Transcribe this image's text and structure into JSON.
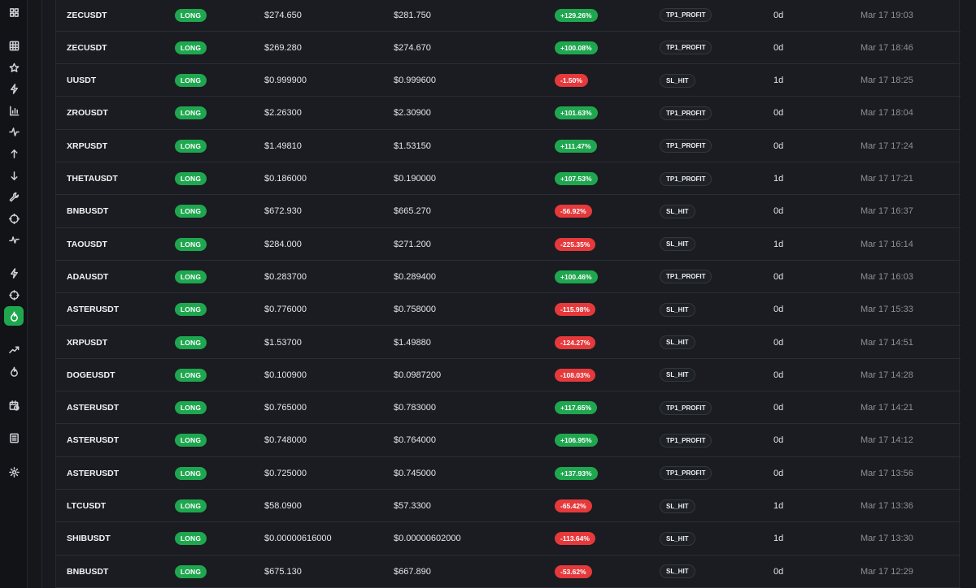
{
  "sidebar": {
    "icons": [
      {
        "name": "dashboard-grid-icon",
        "active": false
      },
      {
        "name": "table-grid-icon",
        "active": false
      },
      {
        "name": "star-icon",
        "active": false
      },
      {
        "name": "lightning-icon",
        "active": false
      },
      {
        "name": "bar-chart-icon",
        "active": false
      },
      {
        "name": "activity-icon",
        "active": false
      },
      {
        "name": "arrow-up-icon",
        "active": false
      },
      {
        "name": "arrow-down-icon",
        "active": false
      },
      {
        "name": "wrench-icon",
        "active": false
      },
      {
        "name": "crosshair-icon",
        "active": false
      },
      {
        "name": "pulse-icon",
        "active": false
      },
      {
        "name": "bolt-icon",
        "active": false
      },
      {
        "name": "target-icon",
        "active": false
      },
      {
        "name": "flame-icon",
        "active": true
      },
      {
        "name": "trending-up-icon",
        "active": false
      },
      {
        "name": "fire-icon",
        "active": false
      },
      {
        "name": "calendar-clock-icon",
        "active": false
      },
      {
        "name": "document-list-icon",
        "active": false
      },
      {
        "name": "settings-gear-icon",
        "active": false
      }
    ]
  },
  "colors": {
    "positive": "#1fa74f",
    "negative": "#e5393b",
    "background": "#17191e"
  },
  "trades": [
    {
      "symbol": "ZECUSDT",
      "side": "LONG",
      "entry": "$274.650",
      "exit": "$281.750",
      "pnl": "+129.26%",
      "pnl_sign": "pos",
      "reason": "TP1_PROFIT",
      "duration": "0d",
      "time": "Mar 17 19:03"
    },
    {
      "symbol": "ZECUSDT",
      "side": "LONG",
      "entry": "$269.280",
      "exit": "$274.670",
      "pnl": "+100.08%",
      "pnl_sign": "pos",
      "reason": "TP1_PROFIT",
      "duration": "0d",
      "time": "Mar 17 18:46"
    },
    {
      "symbol": "UUSDT",
      "side": "LONG",
      "entry": "$0.999900",
      "exit": "$0.999600",
      "pnl": "-1.50%",
      "pnl_sign": "neg",
      "reason": "SL_HIT",
      "duration": "1d",
      "time": "Mar 17 18:25"
    },
    {
      "symbol": "ZROUSDT",
      "side": "LONG",
      "entry": "$2.26300",
      "exit": "$2.30900",
      "pnl": "+101.63%",
      "pnl_sign": "pos",
      "reason": "TP1_PROFIT",
      "duration": "0d",
      "time": "Mar 17 18:04"
    },
    {
      "symbol": "XRPUSDT",
      "side": "LONG",
      "entry": "$1.49810",
      "exit": "$1.53150",
      "pnl": "+111.47%",
      "pnl_sign": "pos",
      "reason": "TP1_PROFIT",
      "duration": "0d",
      "time": "Mar 17 17:24"
    },
    {
      "symbol": "THETAUSDT",
      "side": "LONG",
      "entry": "$0.186000",
      "exit": "$0.190000",
      "pnl": "+107.53%",
      "pnl_sign": "pos",
      "reason": "TP1_PROFIT",
      "duration": "1d",
      "time": "Mar 17 17:21"
    },
    {
      "symbol": "BNBUSDT",
      "side": "LONG",
      "entry": "$672.930",
      "exit": "$665.270",
      "pnl": "-56.92%",
      "pnl_sign": "neg",
      "reason": "SL_HIT",
      "duration": "0d",
      "time": "Mar 17 16:37"
    },
    {
      "symbol": "TAOUSDT",
      "side": "LONG",
      "entry": "$284.000",
      "exit": "$271.200",
      "pnl": "-225.35%",
      "pnl_sign": "neg",
      "reason": "SL_HIT",
      "duration": "1d",
      "time": "Mar 17 16:14"
    },
    {
      "symbol": "ADAUSDT",
      "side": "LONG",
      "entry": "$0.283700",
      "exit": "$0.289400",
      "pnl": "+100.46%",
      "pnl_sign": "pos",
      "reason": "TP1_PROFIT",
      "duration": "0d",
      "time": "Mar 17 16:03"
    },
    {
      "symbol": "ASTERUSDT",
      "side": "LONG",
      "entry": "$0.776000",
      "exit": "$0.758000",
      "pnl": "-115.98%",
      "pnl_sign": "neg",
      "reason": "SL_HIT",
      "duration": "0d",
      "time": "Mar 17 15:33"
    },
    {
      "symbol": "XRPUSDT",
      "side": "LONG",
      "entry": "$1.53700",
      "exit": "$1.49880",
      "pnl": "-124.27%",
      "pnl_sign": "neg",
      "reason": "SL_HIT",
      "duration": "0d",
      "time": "Mar 17 14:51"
    },
    {
      "symbol": "DOGEUSDT",
      "side": "LONG",
      "entry": "$0.100900",
      "exit": "$0.0987200",
      "pnl": "-108.03%",
      "pnl_sign": "neg",
      "reason": "SL_HIT",
      "duration": "0d",
      "time": "Mar 17 14:28"
    },
    {
      "symbol": "ASTERUSDT",
      "side": "LONG",
      "entry": "$0.765000",
      "exit": "$0.783000",
      "pnl": "+117.65%",
      "pnl_sign": "pos",
      "reason": "TP1_PROFIT",
      "duration": "0d",
      "time": "Mar 17 14:21"
    },
    {
      "symbol": "ASTERUSDT",
      "side": "LONG",
      "entry": "$0.748000",
      "exit": "$0.764000",
      "pnl": "+106.95%",
      "pnl_sign": "pos",
      "reason": "TP1_PROFIT",
      "duration": "0d",
      "time": "Mar 17 14:12"
    },
    {
      "symbol": "ASTERUSDT",
      "side": "LONG",
      "entry": "$0.725000",
      "exit": "$0.745000",
      "pnl": "+137.93%",
      "pnl_sign": "pos",
      "reason": "TP1_PROFIT",
      "duration": "0d",
      "time": "Mar 17 13:56"
    },
    {
      "symbol": "LTCUSDT",
      "side": "LONG",
      "entry": "$58.0900",
      "exit": "$57.3300",
      "pnl": "-65.42%",
      "pnl_sign": "neg",
      "reason": "SL_HIT",
      "duration": "1d",
      "time": "Mar 17 13:36"
    },
    {
      "symbol": "SHIBUSDT",
      "side": "LONG",
      "entry": "$0.00000616000",
      "exit": "$0.00000602000",
      "pnl": "-113.64%",
      "pnl_sign": "neg",
      "reason": "SL_HIT",
      "duration": "1d",
      "time": "Mar 17 13:30"
    },
    {
      "symbol": "BNBUSDT",
      "side": "LONG",
      "entry": "$675.130",
      "exit": "$667.890",
      "pnl": "-53.62%",
      "pnl_sign": "neg",
      "reason": "SL_HIT",
      "duration": "0d",
      "time": "Mar 17 12:29"
    }
  ]
}
